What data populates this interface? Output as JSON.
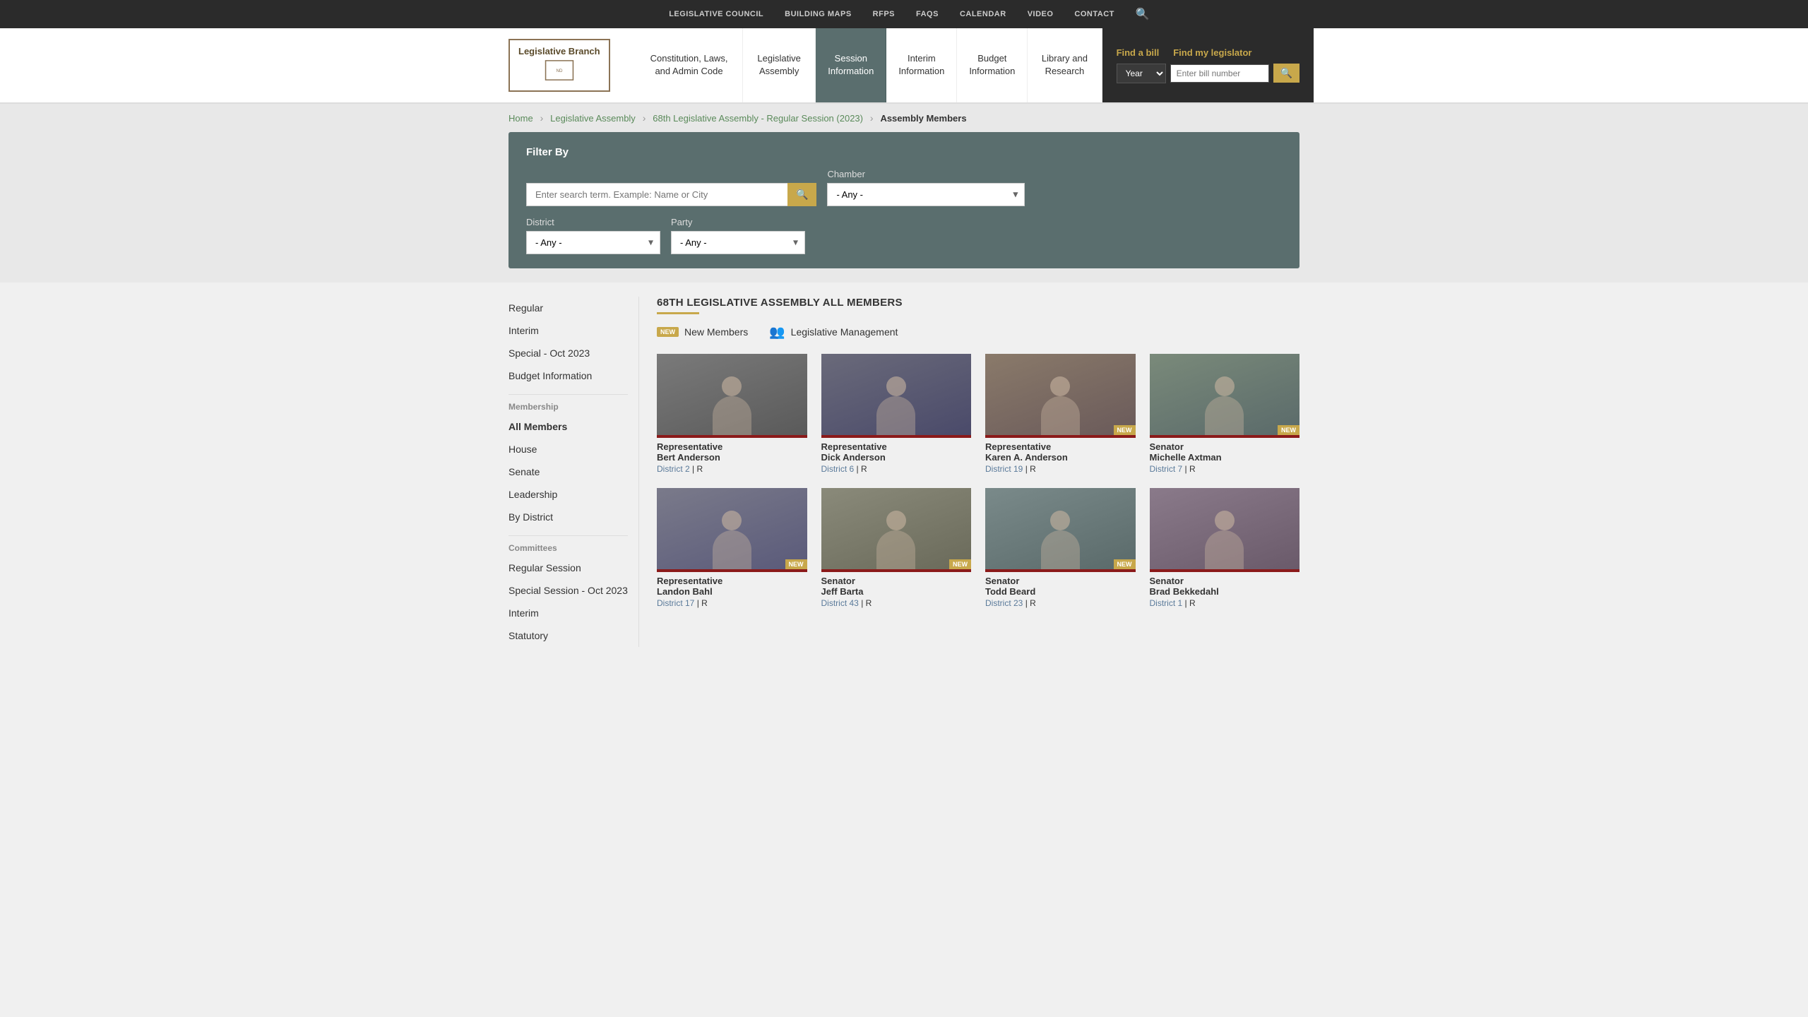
{
  "topNav": {
    "items": [
      {
        "label": "LEGISLATIVE COUNCIL",
        "id": "legislative-council"
      },
      {
        "label": "BUILDING MAPS",
        "id": "building-maps"
      },
      {
        "label": "RFPS",
        "id": "rfps"
      },
      {
        "label": "FAQS",
        "id": "faqs"
      },
      {
        "label": "CALENDAR",
        "id": "calendar"
      },
      {
        "label": "VIDEO",
        "id": "video"
      },
      {
        "label": "CONTACT",
        "id": "contact"
      }
    ]
  },
  "header": {
    "logo": {
      "title": "Legislative Branch",
      "subtitle": ""
    },
    "navItems": [
      {
        "label": "Constitution, Laws, and Admin Code",
        "id": "constitution",
        "active": false
      },
      {
        "label": "Legislative Assembly",
        "id": "legislative-assembly",
        "active": false
      },
      {
        "label": "Session Information",
        "id": "session-info",
        "active": true
      },
      {
        "label": "Interim Information",
        "id": "interim-info",
        "active": false
      },
      {
        "label": "Budget Information",
        "id": "budget-info",
        "active": false
      },
      {
        "label": "Library and Research",
        "id": "library-research",
        "active": false
      }
    ],
    "findBill": {
      "label": "Find a bill",
      "yearPlaceholder": "Year",
      "billPlaceholder": "Enter bill number",
      "myLegislatorLabel": "Find my legislator"
    }
  },
  "breadcrumb": {
    "items": [
      {
        "label": "Home",
        "id": "home"
      },
      {
        "label": "Legislative Assembly",
        "id": "leg-assembly"
      },
      {
        "label": "68th Legislative Assembly - Regular Session (2023)",
        "id": "68th"
      },
      {
        "label": "Assembly Members",
        "id": "assembly-members",
        "current": true
      }
    ]
  },
  "filter": {
    "title": "Filter By",
    "searchPlaceholder": "Enter search term. Example: Name or City",
    "chamberLabel": "Chamber",
    "chamberDefault": "- Any -",
    "districtLabel": "District",
    "districtDefault": "- Any -",
    "partyLabel": "Party",
    "partyDefault": "- Any -"
  },
  "sidebar": {
    "topItems": [
      {
        "label": "Regular",
        "id": "regular",
        "active": false
      },
      {
        "label": "Interim",
        "id": "interim",
        "active": false
      },
      {
        "label": "Special - Oct 2023",
        "id": "special-oct-2023",
        "active": false
      },
      {
        "label": "Budget Information",
        "id": "budget-info",
        "active": false
      }
    ],
    "membershipLabel": "Membership",
    "membershipItems": [
      {
        "label": "All Members",
        "id": "all-members",
        "active": true
      },
      {
        "label": "House",
        "id": "house",
        "active": false
      },
      {
        "label": "Senate",
        "id": "senate",
        "active": false
      },
      {
        "label": "Leadership",
        "id": "leadership",
        "active": false
      },
      {
        "label": "By District",
        "id": "by-district",
        "active": false
      }
    ],
    "committeesLabel": "Committees",
    "committeesItems": [
      {
        "label": "Regular Session",
        "id": "regular-session",
        "active": false
      },
      {
        "label": "Special Session - Oct 2023",
        "id": "special-session-oct-2023",
        "active": false
      },
      {
        "label": "Interim",
        "id": "interim-committee",
        "active": false
      },
      {
        "label": "Statutory",
        "id": "statutory",
        "active": false
      }
    ]
  },
  "mainContent": {
    "title": "68TH LEGISLATIVE ASSEMBLY ALL MEMBERS",
    "filterBadges": [
      {
        "label": "New Members",
        "type": "new-badge"
      },
      {
        "label": "Legislative Management",
        "type": "icon-badge"
      }
    ],
    "members": [
      {
        "title": "Representative",
        "name": "Bert Anderson",
        "district": "District 2",
        "party": "R",
        "isNew": false,
        "photoClass": "photo-1"
      },
      {
        "title": "Representative",
        "name": "Dick Anderson",
        "district": "District 6",
        "party": "R",
        "isNew": false,
        "photoClass": "photo-2"
      },
      {
        "title": "Representative",
        "name": "Karen A. Anderson",
        "district": "District 19",
        "party": "R",
        "isNew": true,
        "photoClass": "photo-3"
      },
      {
        "title": "Senator",
        "name": "Michelle Axtman",
        "district": "District 7",
        "party": "R",
        "isNew": true,
        "photoClass": "photo-4"
      },
      {
        "title": "Representative",
        "name": "Landon Bahl",
        "district": "District 17",
        "party": "R",
        "isNew": true,
        "photoClass": "photo-5"
      },
      {
        "title": "Senator",
        "name": "Jeff Barta",
        "district": "District 43",
        "party": "R",
        "isNew": true,
        "photoClass": "photo-6"
      },
      {
        "title": "Senator",
        "name": "Todd Beard",
        "district": "District 23",
        "party": "R",
        "isNew": true,
        "photoClass": "photo-7"
      },
      {
        "title": "Senator",
        "name": "Brad Bekkedahl",
        "district": "District 1",
        "party": "R",
        "isNew": false,
        "photoClass": "photo-8"
      }
    ]
  }
}
